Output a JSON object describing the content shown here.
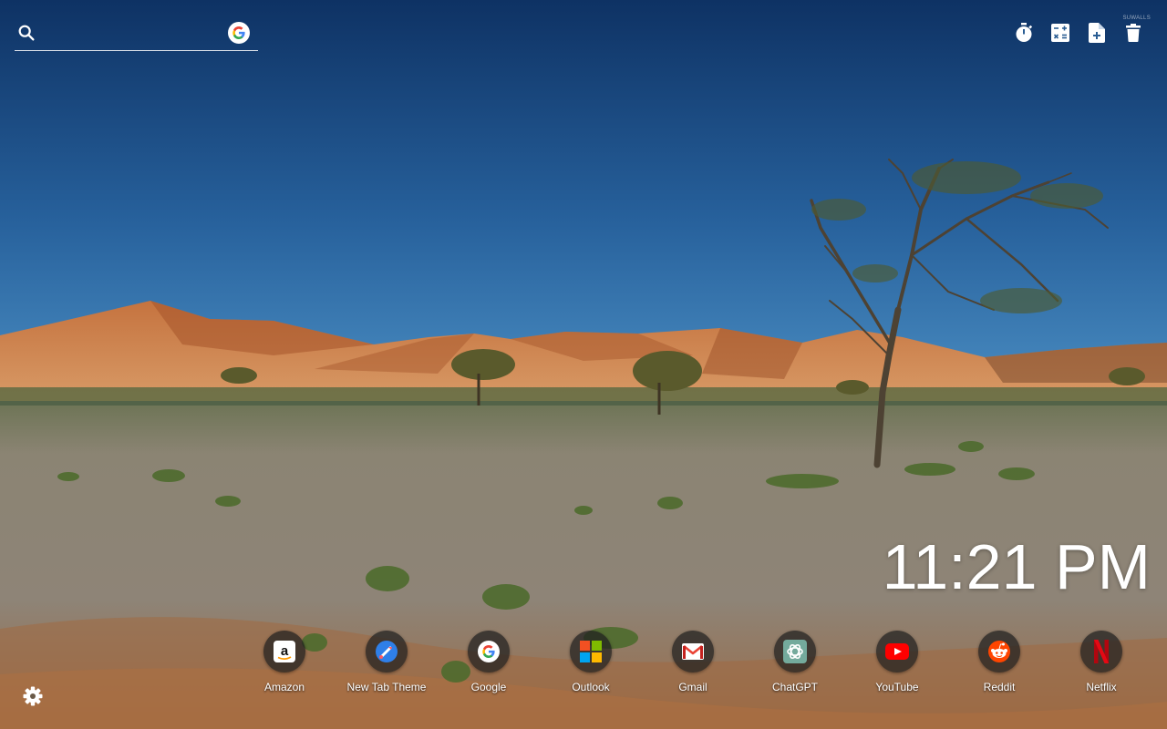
{
  "search": {
    "value": "",
    "placeholder": "",
    "engine": "Google"
  },
  "toolbar": {
    "tools": [
      {
        "icon": "stopwatch-icon"
      },
      {
        "icon": "calculator-icon"
      },
      {
        "icon": "new-note-icon"
      },
      {
        "icon": "trash-icon"
      }
    ],
    "watermark": "SUWALLS"
  },
  "clock": {
    "time": "11:21 PM"
  },
  "shortcuts": [
    {
      "label": "Amazon",
      "icon": "amazon-icon"
    },
    {
      "label": "New Tab Theme",
      "icon": "new-tab-theme-icon"
    },
    {
      "label": "Google",
      "icon": "google-icon"
    },
    {
      "label": "Outlook",
      "icon": "outlook-icon"
    },
    {
      "label": "Gmail",
      "icon": "gmail-icon"
    },
    {
      "label": "ChatGPT",
      "icon": "chatgpt-icon"
    },
    {
      "label": "YouTube",
      "icon": "youtube-icon"
    },
    {
      "label": "Reddit",
      "icon": "reddit-icon"
    },
    {
      "label": "Netflix",
      "icon": "netflix-icon"
    }
  ],
  "settings": {
    "icon": "gear-icon"
  },
  "colors": {
    "sky_top": "#0f3566",
    "sky_horizon": "#3f82b8",
    "dunes": "#c8703e",
    "ground": "#8a8276",
    "text": "#ffffff",
    "tile": "#1e1e1e"
  }
}
